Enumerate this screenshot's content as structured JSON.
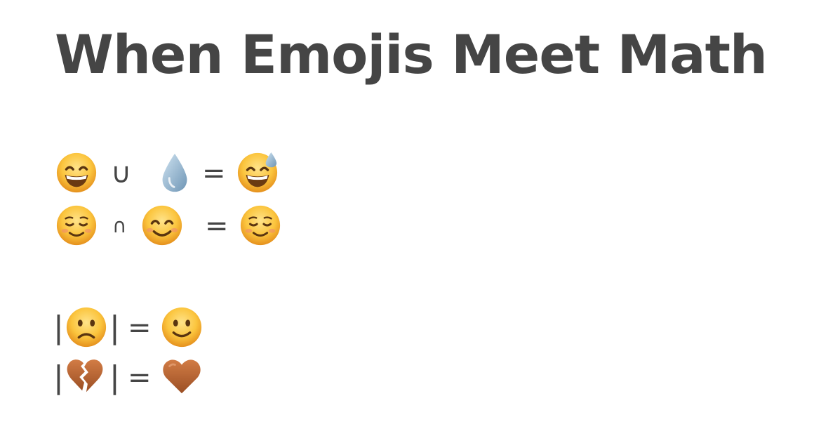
{
  "title": "When Emojis Meet Math",
  "equations": [
    {
      "left": "grinning-face-with-smiling-eyes-icon",
      "operator": "∪",
      "right": "droplet-icon",
      "equals": "=",
      "result": "grinning-face-with-sweat-icon"
    },
    {
      "left": "smiling-face-icon",
      "operator": "∩",
      "right": "smiling-face-with-smiling-eyes-icon",
      "equals": "=",
      "result": "smiling-face-icon"
    },
    {
      "bar_left": "|",
      "inside": "slightly-frowning-face-icon",
      "bar_right": "|",
      "equals": "=",
      "result": "slightly-smiling-face-icon"
    },
    {
      "bar_left": "|",
      "inside": "broken-heart-icon",
      "bar_right": "|",
      "equals": "=",
      "result": "brown-heart-icon"
    }
  ],
  "colors": {
    "text": "#454545",
    "face": "#f6b838",
    "heart": "#b8673a",
    "droplet": "#8eb4cf"
  }
}
